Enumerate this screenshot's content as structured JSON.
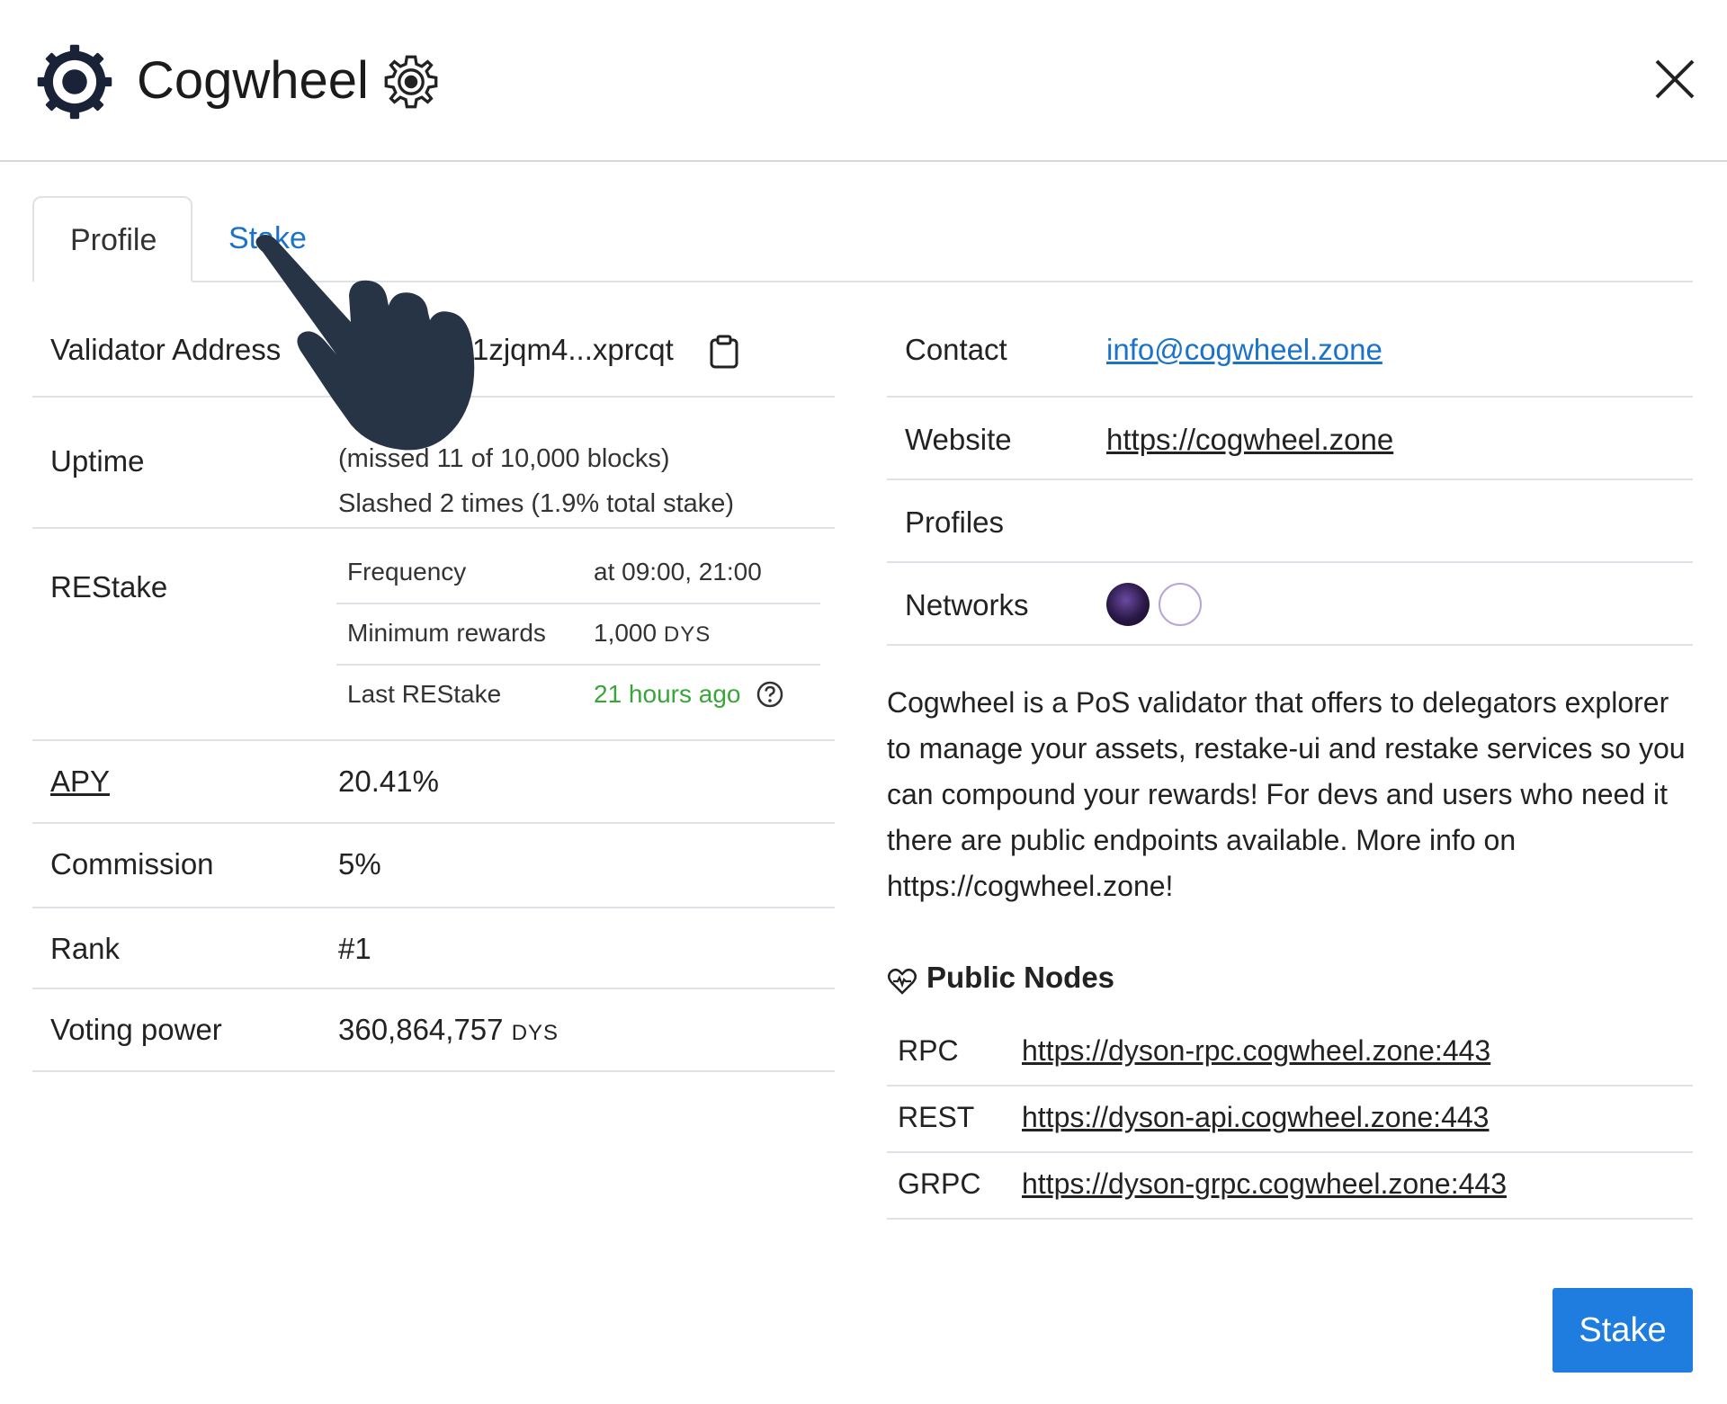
{
  "header": {
    "title": "Cogwheel"
  },
  "tabs": [
    {
      "label": "Profile"
    },
    {
      "label": "Stake"
    }
  ],
  "profile": {
    "validator_address": {
      "label": "Validator Address",
      "value": "r1zjqm4...xprcqt"
    },
    "uptime": {
      "label": "Uptime",
      "line1": "(missed 11 of 10,000 blocks)",
      "line2": "Slashed 2 times (1.9% total stake)"
    },
    "restake": {
      "label": "REStake",
      "rows": [
        {
          "key": "Frequency",
          "value": "at 09:00, 21:00"
        },
        {
          "key": "Minimum rewards",
          "value": "1,000",
          "unit": "DYS"
        },
        {
          "key": "Last REStake",
          "value": "21 hours ago"
        }
      ]
    },
    "apy": {
      "label": "APY",
      "value": "20.41%"
    },
    "commission": {
      "label": "Commission",
      "value": "5%"
    },
    "rank": {
      "label": "Rank",
      "value": "#1"
    },
    "voting_power": {
      "label": "Voting power",
      "value": "360,864,757",
      "unit": "DYS"
    }
  },
  "details": {
    "contact": {
      "label": "Contact",
      "value": "info@cogwheel.zone"
    },
    "website": {
      "label": "Website",
      "value": "https://cogwheel.zone"
    },
    "profiles": {
      "label": "Profiles"
    },
    "networks": {
      "label": "Networks"
    }
  },
  "description": "Cogwheel is a PoS validator that offers to delegators explorer to manage your assets, restake-ui and restake services so you can compound your rewards! For devs and users who need it there are public endpoints available. More info on https://cogwheel.zone!",
  "public_nodes": {
    "title": "Public Nodes",
    "nodes": [
      {
        "type": "RPC",
        "url": "https://dyson-rpc.cogwheel.zone:443"
      },
      {
        "type": "REST",
        "url": "https://dyson-api.cogwheel.zone:443"
      },
      {
        "type": "GRPC",
        "url": "https://dyson-grpc.cogwheel.zone:443"
      }
    ]
  },
  "actions": {
    "stake_label": "Stake"
  },
  "colors": {
    "accent": "#1f7de0",
    "link": "#1a73c9",
    "success": "#3aa53a"
  },
  "icons": [
    "cogwheel-logo-icon",
    "gear-icon",
    "close-icon",
    "clipboard-icon",
    "help-circle-icon",
    "heart-pulse-icon",
    "pointing-hand-cursor-icon"
  ]
}
